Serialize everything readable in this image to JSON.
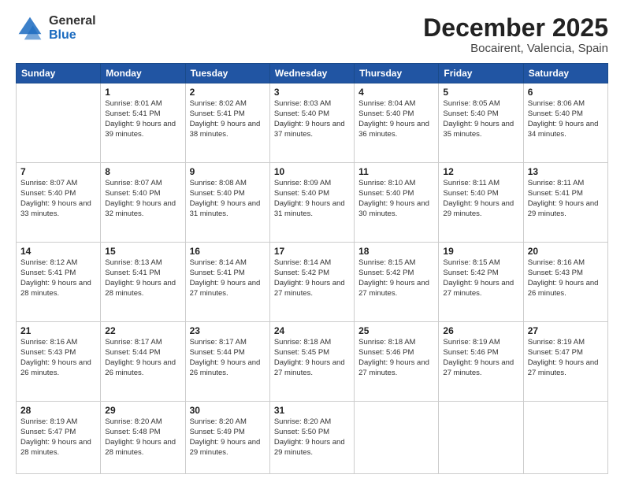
{
  "logo": {
    "general": "General",
    "blue": "Blue"
  },
  "title": "December 2025",
  "location": "Bocairent, Valencia, Spain",
  "headers": [
    "Sunday",
    "Monday",
    "Tuesday",
    "Wednesday",
    "Thursday",
    "Friday",
    "Saturday"
  ],
  "weeks": [
    [
      {
        "num": "",
        "sunrise": "",
        "sunset": "",
        "daylight": ""
      },
      {
        "num": "1",
        "sunrise": "Sunrise: 8:01 AM",
        "sunset": "Sunset: 5:41 PM",
        "daylight": "Daylight: 9 hours and 39 minutes."
      },
      {
        "num": "2",
        "sunrise": "Sunrise: 8:02 AM",
        "sunset": "Sunset: 5:41 PM",
        "daylight": "Daylight: 9 hours and 38 minutes."
      },
      {
        "num": "3",
        "sunrise": "Sunrise: 8:03 AM",
        "sunset": "Sunset: 5:40 PM",
        "daylight": "Daylight: 9 hours and 37 minutes."
      },
      {
        "num": "4",
        "sunrise": "Sunrise: 8:04 AM",
        "sunset": "Sunset: 5:40 PM",
        "daylight": "Daylight: 9 hours and 36 minutes."
      },
      {
        "num": "5",
        "sunrise": "Sunrise: 8:05 AM",
        "sunset": "Sunset: 5:40 PM",
        "daylight": "Daylight: 9 hours and 35 minutes."
      },
      {
        "num": "6",
        "sunrise": "Sunrise: 8:06 AM",
        "sunset": "Sunset: 5:40 PM",
        "daylight": "Daylight: 9 hours and 34 minutes."
      }
    ],
    [
      {
        "num": "7",
        "sunrise": "Sunrise: 8:07 AM",
        "sunset": "Sunset: 5:40 PM",
        "daylight": "Daylight: 9 hours and 33 minutes."
      },
      {
        "num": "8",
        "sunrise": "Sunrise: 8:07 AM",
        "sunset": "Sunset: 5:40 PM",
        "daylight": "Daylight: 9 hours and 32 minutes."
      },
      {
        "num": "9",
        "sunrise": "Sunrise: 8:08 AM",
        "sunset": "Sunset: 5:40 PM",
        "daylight": "Daylight: 9 hours and 31 minutes."
      },
      {
        "num": "10",
        "sunrise": "Sunrise: 8:09 AM",
        "sunset": "Sunset: 5:40 PM",
        "daylight": "Daylight: 9 hours and 31 minutes."
      },
      {
        "num": "11",
        "sunrise": "Sunrise: 8:10 AM",
        "sunset": "Sunset: 5:40 PM",
        "daylight": "Daylight: 9 hours and 30 minutes."
      },
      {
        "num": "12",
        "sunrise": "Sunrise: 8:11 AM",
        "sunset": "Sunset: 5:40 PM",
        "daylight": "Daylight: 9 hours and 29 minutes."
      },
      {
        "num": "13",
        "sunrise": "Sunrise: 8:11 AM",
        "sunset": "Sunset: 5:41 PM",
        "daylight": "Daylight: 9 hours and 29 minutes."
      }
    ],
    [
      {
        "num": "14",
        "sunrise": "Sunrise: 8:12 AM",
        "sunset": "Sunset: 5:41 PM",
        "daylight": "Daylight: 9 hours and 28 minutes."
      },
      {
        "num": "15",
        "sunrise": "Sunrise: 8:13 AM",
        "sunset": "Sunset: 5:41 PM",
        "daylight": "Daylight: 9 hours and 28 minutes."
      },
      {
        "num": "16",
        "sunrise": "Sunrise: 8:14 AM",
        "sunset": "Sunset: 5:41 PM",
        "daylight": "Daylight: 9 hours and 27 minutes."
      },
      {
        "num": "17",
        "sunrise": "Sunrise: 8:14 AM",
        "sunset": "Sunset: 5:42 PM",
        "daylight": "Daylight: 9 hours and 27 minutes."
      },
      {
        "num": "18",
        "sunrise": "Sunrise: 8:15 AM",
        "sunset": "Sunset: 5:42 PM",
        "daylight": "Daylight: 9 hours and 27 minutes."
      },
      {
        "num": "19",
        "sunrise": "Sunrise: 8:15 AM",
        "sunset": "Sunset: 5:42 PM",
        "daylight": "Daylight: 9 hours and 27 minutes."
      },
      {
        "num": "20",
        "sunrise": "Sunrise: 8:16 AM",
        "sunset": "Sunset: 5:43 PM",
        "daylight": "Daylight: 9 hours and 26 minutes."
      }
    ],
    [
      {
        "num": "21",
        "sunrise": "Sunrise: 8:16 AM",
        "sunset": "Sunset: 5:43 PM",
        "daylight": "Daylight: 9 hours and 26 minutes."
      },
      {
        "num": "22",
        "sunrise": "Sunrise: 8:17 AM",
        "sunset": "Sunset: 5:44 PM",
        "daylight": "Daylight: 9 hours and 26 minutes."
      },
      {
        "num": "23",
        "sunrise": "Sunrise: 8:17 AM",
        "sunset": "Sunset: 5:44 PM",
        "daylight": "Daylight: 9 hours and 26 minutes."
      },
      {
        "num": "24",
        "sunrise": "Sunrise: 8:18 AM",
        "sunset": "Sunset: 5:45 PM",
        "daylight": "Daylight: 9 hours and 27 minutes."
      },
      {
        "num": "25",
        "sunrise": "Sunrise: 8:18 AM",
        "sunset": "Sunset: 5:46 PM",
        "daylight": "Daylight: 9 hours and 27 minutes."
      },
      {
        "num": "26",
        "sunrise": "Sunrise: 8:19 AM",
        "sunset": "Sunset: 5:46 PM",
        "daylight": "Daylight: 9 hours and 27 minutes."
      },
      {
        "num": "27",
        "sunrise": "Sunrise: 8:19 AM",
        "sunset": "Sunset: 5:47 PM",
        "daylight": "Daylight: 9 hours and 27 minutes."
      }
    ],
    [
      {
        "num": "28",
        "sunrise": "Sunrise: 8:19 AM",
        "sunset": "Sunset: 5:47 PM",
        "daylight": "Daylight: 9 hours and 28 minutes."
      },
      {
        "num": "29",
        "sunrise": "Sunrise: 8:20 AM",
        "sunset": "Sunset: 5:48 PM",
        "daylight": "Daylight: 9 hours and 28 minutes."
      },
      {
        "num": "30",
        "sunrise": "Sunrise: 8:20 AM",
        "sunset": "Sunset: 5:49 PM",
        "daylight": "Daylight: 9 hours and 29 minutes."
      },
      {
        "num": "31",
        "sunrise": "Sunrise: 8:20 AM",
        "sunset": "Sunset: 5:50 PM",
        "daylight": "Daylight: 9 hours and 29 minutes."
      },
      {
        "num": "",
        "sunrise": "",
        "sunset": "",
        "daylight": ""
      },
      {
        "num": "",
        "sunrise": "",
        "sunset": "",
        "daylight": ""
      },
      {
        "num": "",
        "sunrise": "",
        "sunset": "",
        "daylight": ""
      }
    ]
  ]
}
